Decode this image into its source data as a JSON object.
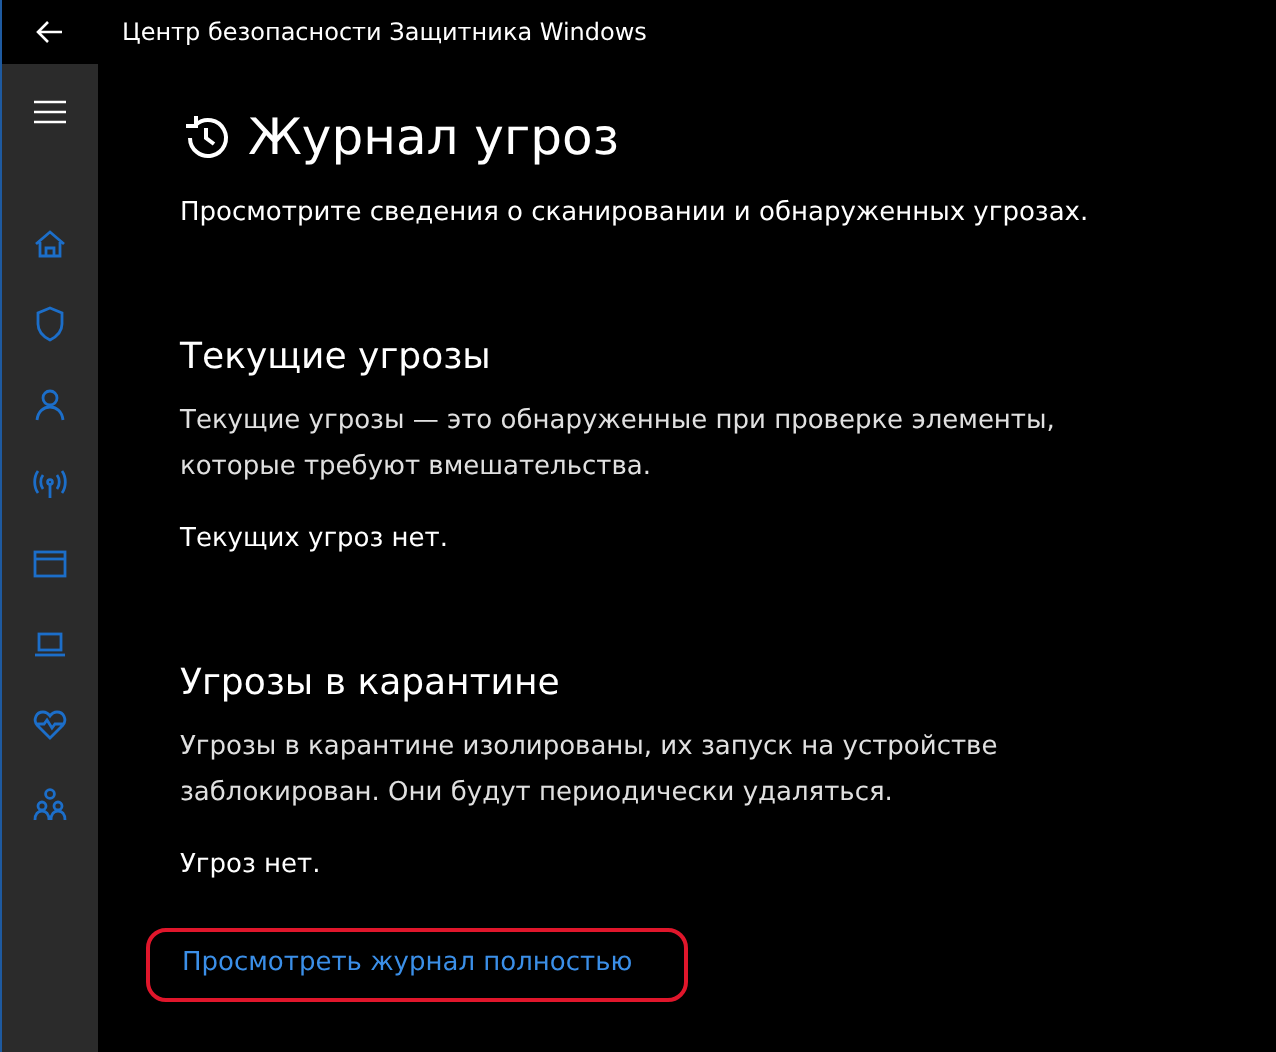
{
  "window": {
    "title": "Центр безопасности Защитника Windows"
  },
  "page": {
    "title": "Журнал угроз",
    "subtitle": "Просмотрите сведения о сканировании и обнаруженных угрозах."
  },
  "sections": [
    {
      "heading": "Текущие угрозы",
      "description": "Текущие угрозы — это обнаруженные при проверке элементы, которые требуют вмешательства.",
      "status": "Текущих угроз нет."
    },
    {
      "heading": "Угрозы в карантине",
      "description": "Угрозы в карантине изолированы, их запуск на устройстве заблокирован. Они будут периодически удаляться.",
      "status": "Угроз нет."
    }
  ],
  "link": {
    "label": "Просмотреть журнал полностью",
    "highlighted": true
  }
}
